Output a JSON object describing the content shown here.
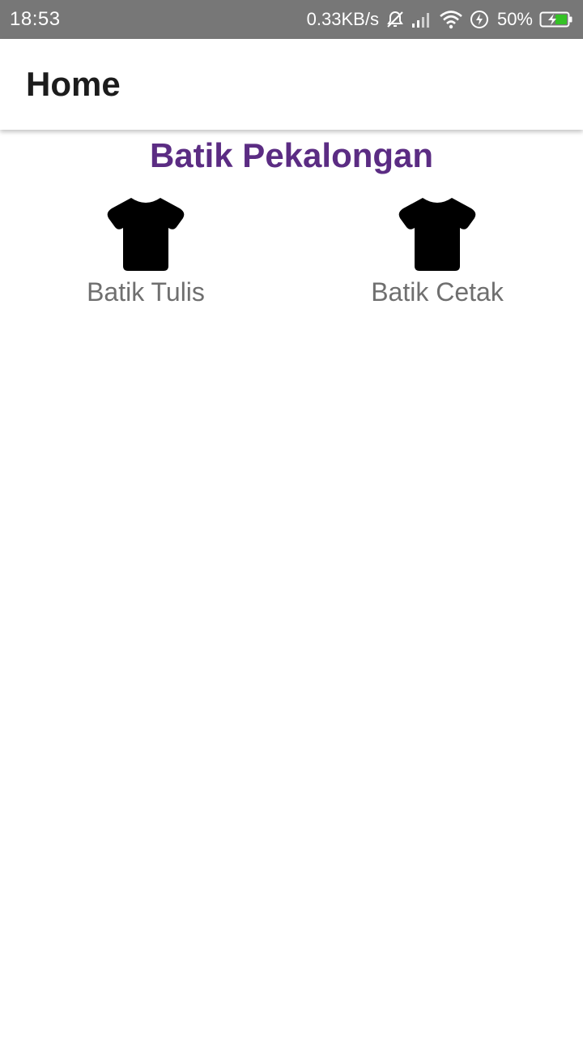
{
  "status_bar": {
    "time": "18:53",
    "net_speed": "0.33KB/s",
    "battery": "50%",
    "icons": [
      "alarm-off-icon",
      "signal-icon",
      "wifi-icon",
      "charging-icon",
      "battery-icon"
    ],
    "battery_color": "#35c226"
  },
  "app_bar": {
    "title": "Home"
  },
  "main": {
    "heading": "Batik Pekalongan",
    "heading_color": "#5b2c83",
    "items": [
      {
        "label": "Batik Tulis",
        "icon": "tshirt-icon"
      },
      {
        "label": "Batik Cetak",
        "icon": "tshirt-icon"
      }
    ]
  }
}
